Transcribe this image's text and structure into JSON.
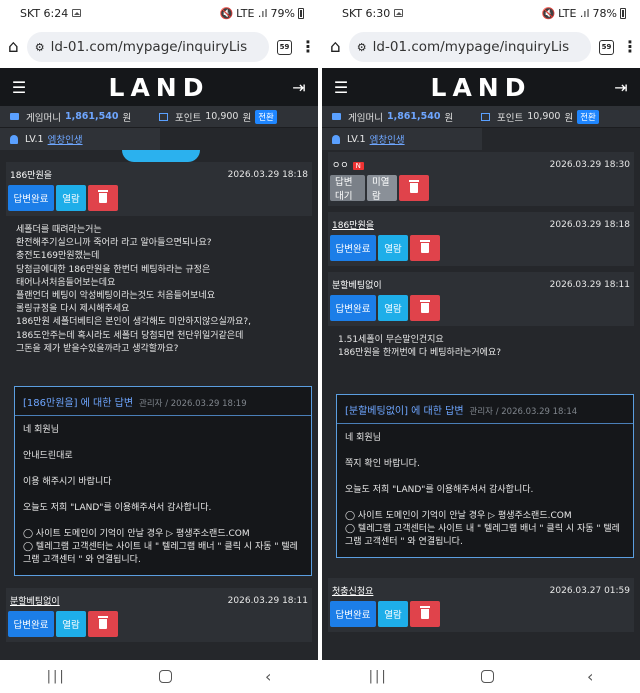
{
  "left": {
    "status": {
      "carrier": "SKT 6:24",
      "signal": "LTE .ıl",
      "battery": "79%"
    },
    "url": "ld-01.com/mypage/inquiryLis",
    "tab_count": "59",
    "brand": "LAND",
    "info": {
      "money_label": "게임머니",
      "money_value": "1,861,540",
      "money_unit": "원",
      "point_label": "포인트",
      "point_value": "10,900",
      "point_unit": "원",
      "convert": "전환"
    },
    "level": {
      "label": "LV.1",
      "nickname": "엠창인생"
    },
    "entries": [
      {
        "title": "186만원을",
        "date": "2026.03.29 18:18",
        "buttons": {
          "status": "답변완료",
          "view": "열람"
        },
        "body": [
          "세폴더를 때려라는거는",
          "환전해주기실으니까 죽어라 라고 알아들으면되나요?",
          "충전도169만원했는데",
          "당첨금에대한 186만원을 한번더 베팅하라는 규정은",
          "태어나서처음들어보는데요",
          " 플랜언더 베팅이 악성베팅이라는것도 처음들어보네요",
          "롤링규정을 다시 제시해주세요",
          "186만원 세폴더베티은 본인이 생각해도 미안하지않으실까요?,",
          "186도안주는데 혹시라도 세폴더 당첨되면 천단위일거같은데",
          "그돈을 제가 받을수있을까라고 생각할까요?"
        ],
        "reply": {
          "title": "[186만원을] 에 대한 답변",
          "meta": "관리자 / 2026.03.29 18:19",
          "lines": [
            "네 회원님",
            "안내드린대로",
            "이용 해주시기 바랍니다",
            "오늘도 저희 \"LAND\"를 이용해주셔서 감사합니다.",
            "◯ 사이트 도메인이 기억이 안날 경우 ▷ 평생주소랜드.COM",
            "◯ 텔레그램 고객센터는 사이트 내 \" 텔레그램 배너 \" 클릭 시 자동 \" 텔레그램 고객센터 \" 와 연결됩니다."
          ]
        }
      },
      {
        "title": "분할베팅없이",
        "date": "2026.03.29 18:11",
        "buttons": {
          "status": "답변완료",
          "view": "열람"
        }
      }
    ]
  },
  "right": {
    "status": {
      "carrier": "SKT 6:30",
      "signal": "LTE .ıl",
      "battery": "78%"
    },
    "url": "ld-01.com/mypage/inquiryLis",
    "tab_count": "59",
    "brand": "LAND",
    "info": {
      "money_label": "게임머니",
      "money_value": "1,861,540",
      "money_unit": "원",
      "point_label": "포인트",
      "point_value": "10,900",
      "point_unit": "원",
      "convert": "전환"
    },
    "level": {
      "label": "LV.1",
      "nickname": "엠창인생"
    },
    "entries": [
      {
        "title": "ㅇㅇ",
        "badge": "N",
        "date": "2026.03.29 18:30",
        "buttons": {
          "status": "답변대기",
          "view": "미열람"
        }
      },
      {
        "title": "186만원을",
        "date": "2026.03.29 18:18",
        "buttons": {
          "status": "답변완료",
          "view": "열람"
        }
      },
      {
        "title": "분할베팅없이",
        "date": "2026.03.29 18:11",
        "buttons": {
          "status": "답변완료",
          "view": "열람"
        },
        "body": [
          "1.51세폴이 무슨말인건지요",
          "186만원을 한꺼번에 다 베팅하라는거에요?"
        ],
        "reply": {
          "title": "[분할베팅없이] 에 대한 답변",
          "meta": "관리자 / 2026.03.29 18:14",
          "lines": [
            "네 회원님",
            "쪽지 확인 바랍니다.",
            "오늘도 저희 \"LAND\"를 이용해주셔서 감사합니다.",
            "◯ 사이트 도메인이 기억이 안날 경우 ▷ 평생주소랜드.COM",
            "◯ 텔레그램 고객센터는 사이트 내 \" 텔레그램 배너 \" 클릭 시 자동 \" 텔레그램 고객센터 \" 와 연결됩니다."
          ]
        }
      },
      {
        "title": "첫충신청요",
        "date": "2026.03.27 01:59",
        "buttons": {
          "status": "답변완료",
          "view": "열람"
        }
      }
    ]
  }
}
